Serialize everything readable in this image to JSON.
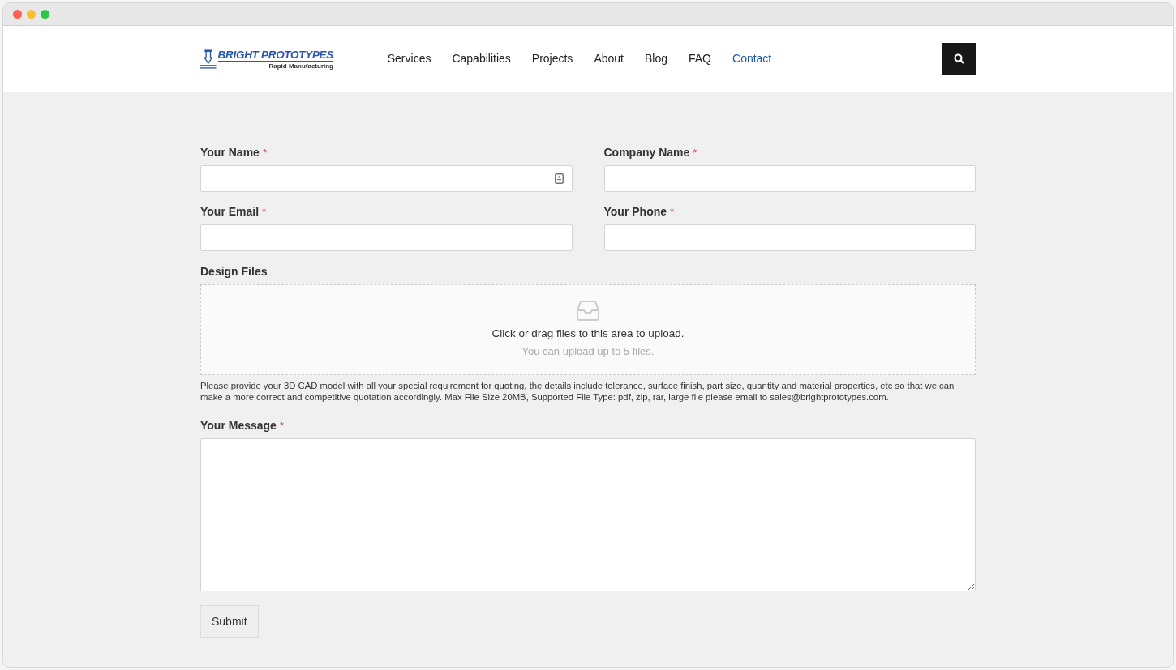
{
  "logo": {
    "name": "BRIGHT PROTOTYPES",
    "tagline": "Rapid Manufacturing"
  },
  "nav": [
    {
      "label": "Services",
      "selected": false
    },
    {
      "label": "Capabilities",
      "selected": false
    },
    {
      "label": "Projects",
      "selected": false
    },
    {
      "label": "About",
      "selected": false
    },
    {
      "label": "Blog",
      "selected": false
    },
    {
      "label": "FAQ",
      "selected": false
    },
    {
      "label": "Contact",
      "selected": true
    }
  ],
  "fields": [
    {
      "label": "Your Name",
      "required_mark": "*",
      "autofill_icon": true
    },
    {
      "label": "Company Name",
      "required_mark": "*",
      "autofill_icon": false
    },
    {
      "label": "Your Email",
      "required_mark": "*",
      "autofill_icon": false
    },
    {
      "label": "Your Phone",
      "required_mark": "*",
      "autofill_icon": false
    }
  ],
  "upload": {
    "label": "Design Files",
    "prompt": "Click or drag files to this area to upload.",
    "hint": "You can upload up to 5 files.",
    "note": "Please provide your 3D CAD model with all your special requirement for quoting, the details include tolerance, surface finish, part size, quantity and material properties, etc so that we can make a more correct and competitive quotation accordingly. Max File Size 20MB, Supported File Type: pdf, zip, rar, large file please email to sales@brightprototypes.com."
  },
  "message": {
    "label": "Your Message",
    "required_mark": "*"
  },
  "submit": "Submit"
}
